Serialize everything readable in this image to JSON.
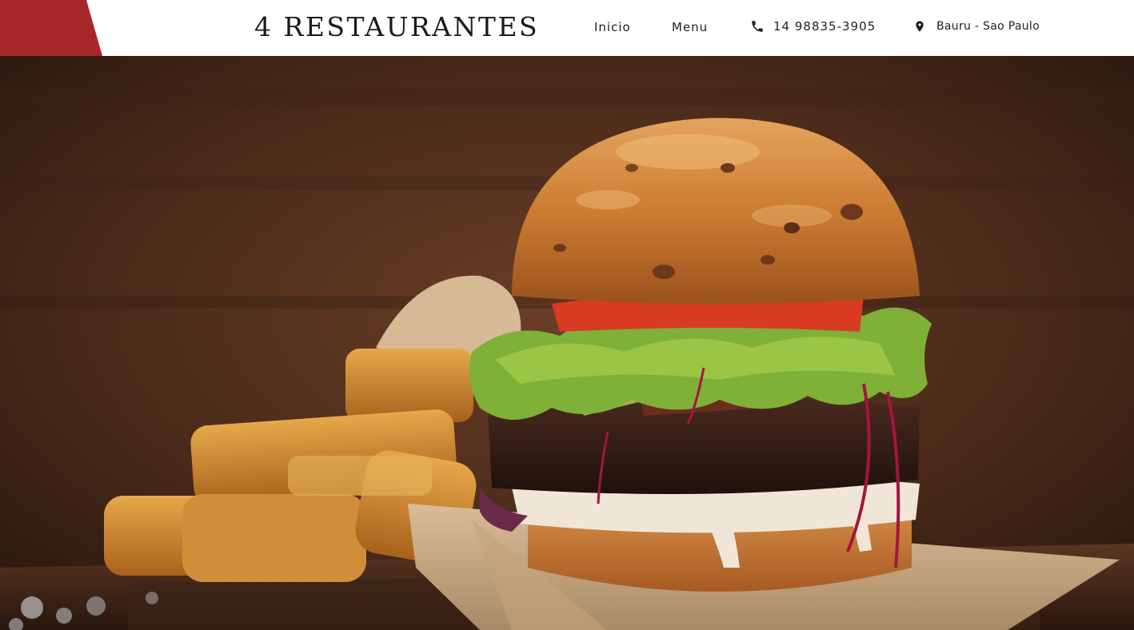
{
  "header": {
    "brand": "4 RESTAURANTES",
    "nav": [
      {
        "label": "Inicio"
      },
      {
        "label": "Menu"
      }
    ],
    "phone": {
      "icon": "phone-icon",
      "text": "14 98835-3905"
    },
    "location": {
      "icon": "map-pin-icon",
      "text": "Bauru - Sao Paulo"
    }
  },
  "colors": {
    "accent": "#a8272b",
    "header_bg": "#ffffff",
    "text": "#1f1f1f"
  },
  "hero": {
    "image": "burger-with-potato-wedges-photo"
  }
}
